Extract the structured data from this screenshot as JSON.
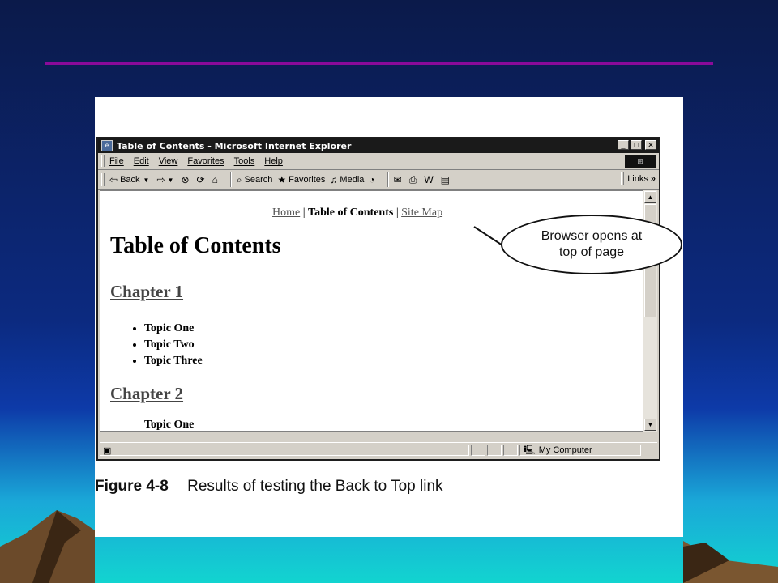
{
  "browser": {
    "title": "Table of Contents - Microsoft Internet Explorer",
    "menu": [
      "File",
      "Edit",
      "View",
      "Favorites",
      "Tools",
      "Help"
    ],
    "toolbar": {
      "back": "Back",
      "search": "Search",
      "favorites": "Favorites",
      "media": "Media",
      "links": "Links"
    },
    "status_zone": "My Computer"
  },
  "page": {
    "nav": {
      "home": "Home",
      "sep1": "|",
      "current": "Table of Contents",
      "sep2": "|",
      "sitemap": "Site Map"
    },
    "heading": "Table of Contents",
    "chapter1": "Chapter 1",
    "topics": [
      "Topic One",
      "Topic Two",
      "Topic Three"
    ],
    "chapter2": "Chapter 2",
    "clipped_text": "Topic One"
  },
  "callout": "Browser opens at top of page",
  "caption": {
    "figure": "Figure 4-8",
    "text": "Results of testing the Back to Top link"
  },
  "colors": {
    "rule": "#8a0a9a",
    "background_top": "#0b1a4a",
    "background_bottom": "#12d4d0"
  }
}
